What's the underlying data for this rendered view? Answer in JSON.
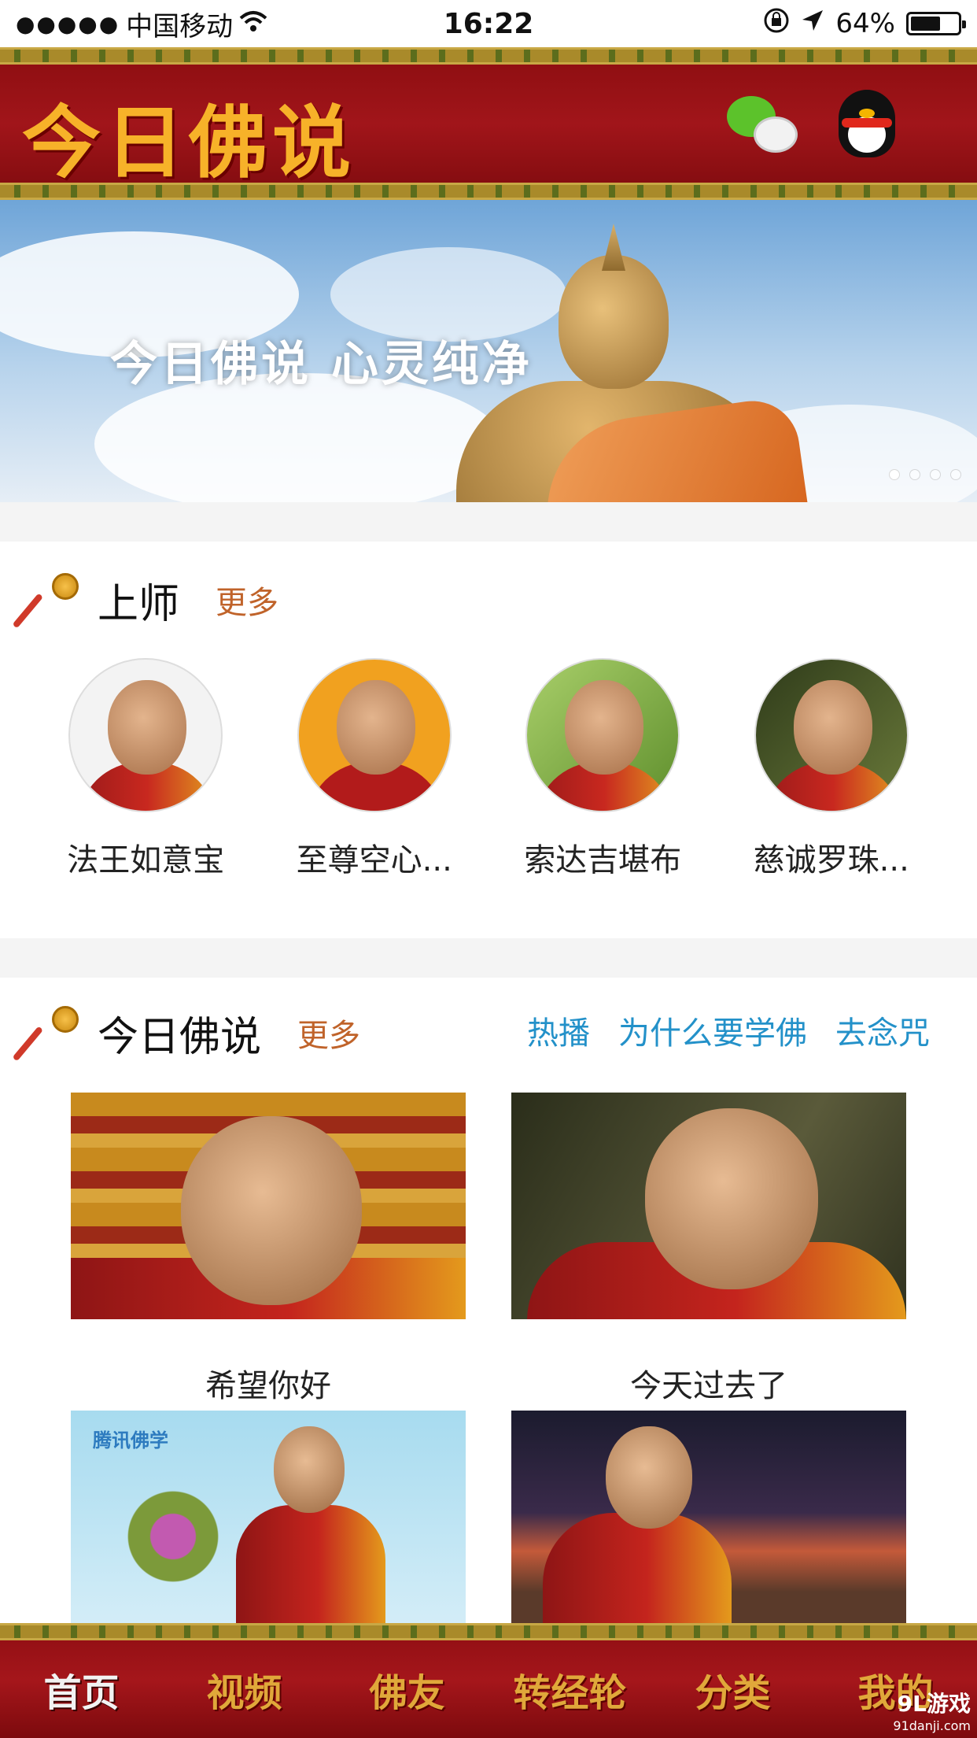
{
  "status_bar": {
    "signal": "●●●●●",
    "carrier": "中国移动",
    "time": "16:22",
    "battery": "64%"
  },
  "header": {
    "logo": "今日佛说",
    "icons": [
      "wechat-icon",
      "qq-icon"
    ]
  },
  "banner": {
    "text": "今日佛说 心灵纯净",
    "slides": 4,
    "active_slide": 1
  },
  "masters_section": {
    "title": "上师",
    "more": "更多",
    "items": [
      {
        "name": "法王如意宝"
      },
      {
        "name": "至尊空心..."
      },
      {
        "name": "索达吉堪布"
      },
      {
        "name": "慈诚罗珠..."
      }
    ]
  },
  "today_section": {
    "title": "今日佛说",
    "more": "更多",
    "tags": [
      "热播",
      "为什么要学佛",
      "去念咒"
    ],
    "videos": [
      {
        "title": "希望你好"
      },
      {
        "title": "今天过去了"
      },
      {
        "title": "",
        "thumb_text": "腾讯佛学"
      },
      {
        "title": ""
      }
    ]
  },
  "tabbar": {
    "items": [
      "首页",
      "视频",
      "佛友",
      "转经轮",
      "分类",
      "我的"
    ],
    "active_index": 0
  },
  "watermark": {
    "main": "9L游戏",
    "sub": "91danji.com"
  },
  "colors": {
    "header_red": "#a1151a",
    "gold": "#f7b229",
    "more_orange": "#c0632a",
    "tag_blue": "#2391c9"
  }
}
